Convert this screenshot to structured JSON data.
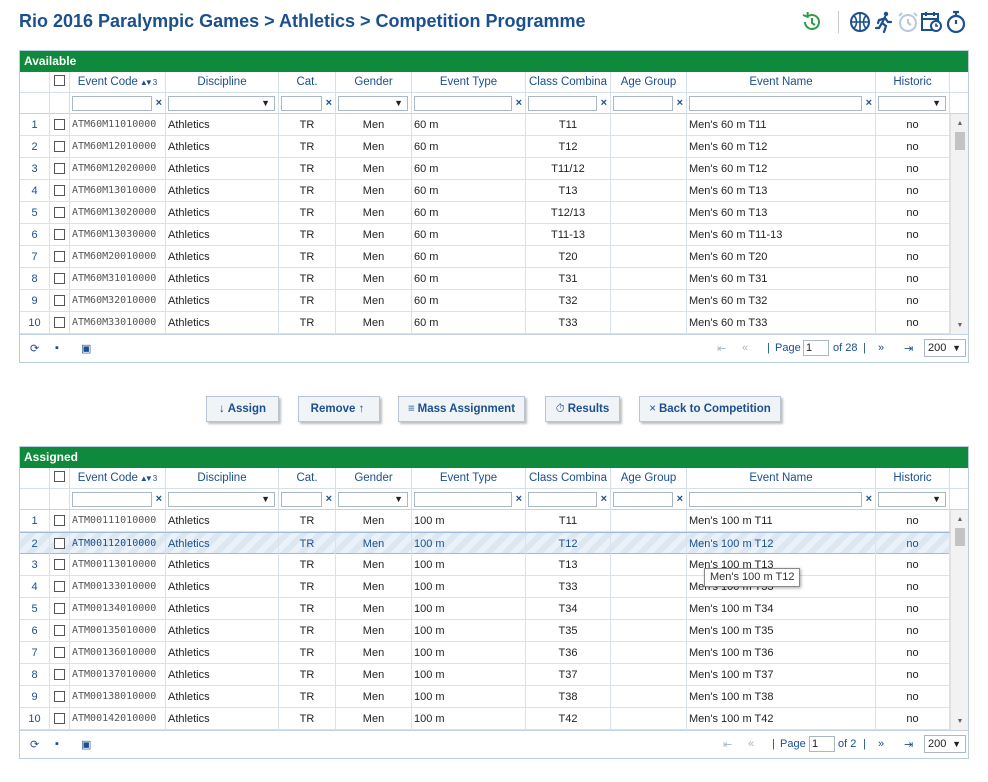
{
  "page": {
    "title": "Rio 2016 Paralympic Games > Athletics > Competition Programme"
  },
  "toolbar_icons": [
    "history-icon",
    "basketball-icon",
    "runner-icon",
    "alarm-clock-icon",
    "calendar-clock-icon",
    "stopwatch-icon"
  ],
  "columns": [
    {
      "key": "code",
      "label": "Event Code",
      "sort": "3",
      "filter": "text"
    },
    {
      "key": "discipline",
      "label": "Discipline",
      "filter": "select"
    },
    {
      "key": "cat",
      "label": "Cat.",
      "filter": "text"
    },
    {
      "key": "gender",
      "label": "Gender",
      "filter": "select"
    },
    {
      "key": "type",
      "label": "Event Type",
      "filter": "text"
    },
    {
      "key": "class",
      "label": "Class Combina",
      "filter": "text"
    },
    {
      "key": "age",
      "label": "Age Group",
      "filter": "text"
    },
    {
      "key": "name",
      "label": "Event Name",
      "filter": "text"
    },
    {
      "key": "historic",
      "label": "Historic",
      "filter": "select"
    }
  ],
  "available": {
    "title": "Available",
    "rows": [
      {
        "n": "1",
        "code": "ATM60M11010000",
        "discipline": "Athletics",
        "cat": "TR",
        "gender": "Men",
        "type": "60 m",
        "class": "T11",
        "age": "",
        "name": "Men's 60 m T11",
        "historic": "no"
      },
      {
        "n": "2",
        "code": "ATM60M12010000",
        "discipline": "Athletics",
        "cat": "TR",
        "gender": "Men",
        "type": "60 m",
        "class": "T12",
        "age": "",
        "name": "Men's 60 m T12",
        "historic": "no"
      },
      {
        "n": "3",
        "code": "ATM60M12020000",
        "discipline": "Athletics",
        "cat": "TR",
        "gender": "Men",
        "type": "60 m",
        "class": "T11/12",
        "age": "",
        "name": "Men's 60 m T12",
        "historic": "no"
      },
      {
        "n": "4",
        "code": "ATM60M13010000",
        "discipline": "Athletics",
        "cat": "TR",
        "gender": "Men",
        "type": "60 m",
        "class": "T13",
        "age": "",
        "name": "Men's 60 m T13",
        "historic": "no"
      },
      {
        "n": "5",
        "code": "ATM60M13020000",
        "discipline": "Athletics",
        "cat": "TR",
        "gender": "Men",
        "type": "60 m",
        "class": "T12/13",
        "age": "",
        "name": "Men's 60 m T13",
        "historic": "no"
      },
      {
        "n": "6",
        "code": "ATM60M13030000",
        "discipline": "Athletics",
        "cat": "TR",
        "gender": "Men",
        "type": "60 m",
        "class": "T11-13",
        "age": "",
        "name": "Men's 60 m T11-13",
        "historic": "no"
      },
      {
        "n": "7",
        "code": "ATM60M20010000",
        "discipline": "Athletics",
        "cat": "TR",
        "gender": "Men",
        "type": "60 m",
        "class": "T20",
        "age": "",
        "name": "Men's 60 m T20",
        "historic": "no"
      },
      {
        "n": "8",
        "code": "ATM60M31010000",
        "discipline": "Athletics",
        "cat": "TR",
        "gender": "Men",
        "type": "60 m",
        "class": "T31",
        "age": "",
        "name": "Men's 60 m T31",
        "historic": "no"
      },
      {
        "n": "9",
        "code": "ATM60M32010000",
        "discipline": "Athletics",
        "cat": "TR",
        "gender": "Men",
        "type": "60 m",
        "class": "T32",
        "age": "",
        "name": "Men's 60 m T32",
        "historic": "no"
      },
      {
        "n": "10",
        "code": "ATM60M33010000",
        "discipline": "Athletics",
        "cat": "TR",
        "gender": "Men",
        "type": "60 m",
        "class": "T33",
        "age": "",
        "name": "Men's 60 m T33",
        "historic": "no"
      }
    ],
    "pager": {
      "page_label": "Page",
      "page": "1",
      "of": "of 28",
      "size": "200"
    }
  },
  "assigned": {
    "title": "Assigned",
    "rows": [
      {
        "n": "1",
        "code": "ATM00111010000",
        "discipline": "Athletics",
        "cat": "TR",
        "gender": "Men",
        "type": "100 m",
        "class": "T11",
        "age": "",
        "name": "Men's 100 m T11",
        "historic": "no"
      },
      {
        "n": "2",
        "code": "ATM00112010000",
        "discipline": "Athletics",
        "cat": "TR",
        "gender": "Men",
        "type": "100 m",
        "class": "T12",
        "age": "",
        "name": "Men's 100 m T12",
        "historic": "no",
        "selected": true
      },
      {
        "n": "3",
        "code": "ATM00113010000",
        "discipline": "Athletics",
        "cat": "TR",
        "gender": "Men",
        "type": "100 m",
        "class": "T13",
        "age": "",
        "name": "Men's 100 m T13",
        "historic": "no"
      },
      {
        "n": "4",
        "code": "ATM00133010000",
        "discipline": "Athletics",
        "cat": "TR",
        "gender": "Men",
        "type": "100 m",
        "class": "T33",
        "age": "",
        "name": "Men's 100 m T33",
        "historic": "no"
      },
      {
        "n": "5",
        "code": "ATM00134010000",
        "discipline": "Athletics",
        "cat": "TR",
        "gender": "Men",
        "type": "100 m",
        "class": "T34",
        "age": "",
        "name": "Men's 100 m T34",
        "historic": "no"
      },
      {
        "n": "6",
        "code": "ATM00135010000",
        "discipline": "Athletics",
        "cat": "TR",
        "gender": "Men",
        "type": "100 m",
        "class": "T35",
        "age": "",
        "name": "Men's 100 m T35",
        "historic": "no"
      },
      {
        "n": "7",
        "code": "ATM00136010000",
        "discipline": "Athletics",
        "cat": "TR",
        "gender": "Men",
        "type": "100 m",
        "class": "T36",
        "age": "",
        "name": "Men's 100 m T36",
        "historic": "no"
      },
      {
        "n": "8",
        "code": "ATM00137010000",
        "discipline": "Athletics",
        "cat": "TR",
        "gender": "Men",
        "type": "100 m",
        "class": "T37",
        "age": "",
        "name": "Men's 100 m T37",
        "historic": "no"
      },
      {
        "n": "9",
        "code": "ATM00138010000",
        "discipline": "Athletics",
        "cat": "TR",
        "gender": "Men",
        "type": "100 m",
        "class": "T38",
        "age": "",
        "name": "Men's 100 m T38",
        "historic": "no"
      },
      {
        "n": "10",
        "code": "ATM00142010000",
        "discipline": "Athletics",
        "cat": "TR",
        "gender": "Men",
        "type": "100 m",
        "class": "T42",
        "age": "",
        "name": "Men's 100 m T42",
        "historic": "no"
      }
    ],
    "pager": {
      "page_label": "Page",
      "page": "1",
      "of": "of 2",
      "size": "200"
    },
    "tooltip": "Men's 100 m T12"
  },
  "actions": {
    "assign": {
      "icon": "↓",
      "label": "Assign"
    },
    "remove": {
      "label": "Remove",
      "icon": "↑"
    },
    "mass": {
      "icon": "≡",
      "label": "Mass Assignment"
    },
    "results": {
      "icon": "⏱",
      "label": "Results"
    },
    "back": {
      "icon": "×",
      "label": "Back to Competition"
    }
  },
  "colors": {
    "header_green": "#0f8a3c",
    "title_blue": "#1b4f8f",
    "history_green": "#2e9a4a",
    "icon_blue": "#1b4f8f",
    "icon_disabled": "#b7c9de"
  }
}
